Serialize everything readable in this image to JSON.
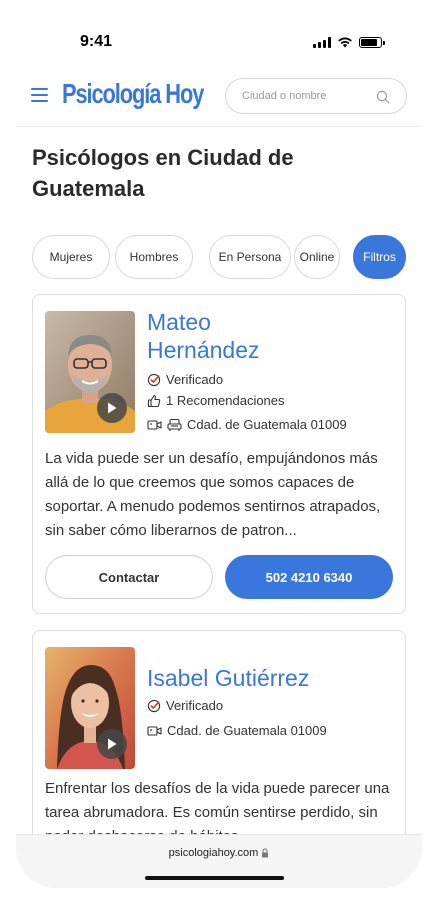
{
  "status_bar": {
    "time": "9:41",
    "battery_level": 0.85
  },
  "header": {
    "logo_text": "Psicología Hoy",
    "search_placeholder": "Ciudad o nombre",
    "brand_color": "#3a77dc"
  },
  "page_title": "Psicólogos en Ciudad de Guatemala",
  "filters": [
    {
      "label": "Mujeres",
      "active": false
    },
    {
      "label": "Hombres",
      "active": false
    },
    {
      "label": "En Persona",
      "active": false
    },
    {
      "label": "Online",
      "active": false
    },
    {
      "label": "Filtros",
      "active": true
    }
  ],
  "profiles": [
    {
      "name_line1": "Mateo",
      "name_line2": "Hernández",
      "verified": "Verificado",
      "recommendations": "1 Recomendaciones",
      "location": "Cdad. de Guatemala 01009",
      "bio": "La vida puede ser un desafío, empujándonos más allá de lo que creemos que somos capaces de soportar. A menudo podemos sentirnos atrapados, sin saber cómo liberarnos de patron...",
      "contact_label": "Contactar",
      "phone": "502 4210 6340"
    },
    {
      "name": "Isabel Gutiérrez",
      "verified": "Verificado",
      "location": "Cdad. de Guatemala 01009",
      "bio": "Enfrentar los desafíos de la vida puede parecer una tarea abrumadora. Es común sentirse perdido, sin poder deshacerse de hábitos"
    }
  ],
  "browser": {
    "url": "psicologiahoy.com"
  },
  "icons": {
    "menu": "hamburger-menu-icon",
    "search": "magnifier-icon",
    "verified": "check-badge-icon",
    "recommend": "thumbs-up-icon",
    "video": "video-camera-icon",
    "in_person": "armchair-icon",
    "play": "play-icon",
    "lock": "lock-icon"
  }
}
